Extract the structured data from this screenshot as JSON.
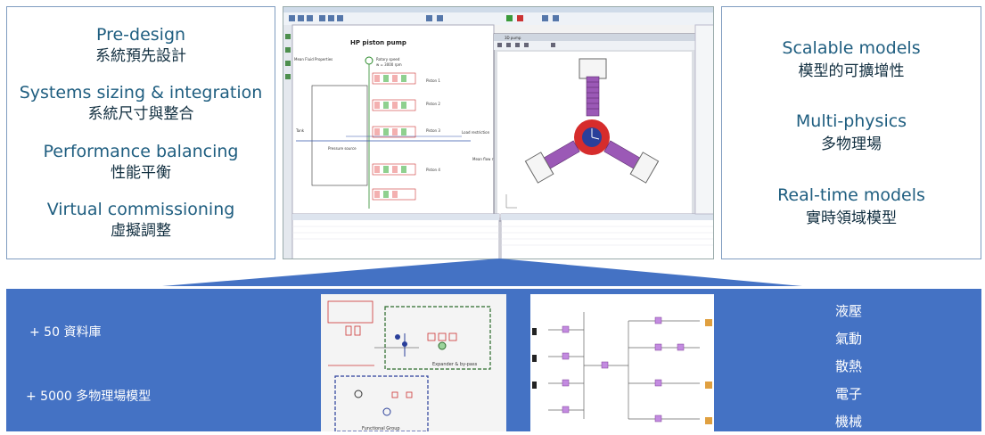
{
  "left_panel": {
    "items": [
      {
        "en": "Pre-design",
        "zh": "系統預先設計"
      },
      {
        "en": "Systems sizing & integration",
        "zh": "系統尺寸與整合"
      },
      {
        "en": "Performance balancing",
        "zh": "性能平衡"
      },
      {
        "en": "Virtual commissioning",
        "zh": "虛擬調整"
      }
    ]
  },
  "right_panel": {
    "items": [
      {
        "en": "Scalable models",
        "zh": "模型的可擴增性"
      },
      {
        "en": "Multi-physics",
        "zh": "多物理場"
      },
      {
        "en": "Real-time models",
        "zh": "實時領域模型"
      }
    ]
  },
  "screenshot": {
    "diagram_title": "HP piston pump",
    "window_3d_title": "3D pump",
    "labels": {
      "tank": "Tank",
      "pressure_source": "Pressure source",
      "load_restriction": "Load restriction",
      "piston_1": "Piston 1",
      "piston_2": "Piston 2",
      "piston_3": "Piston 3",
      "piston_4": "Piston 4",
      "rotary_speed": "Rotary speed",
      "rpm": "w = 3000 rpm",
      "mean_flow": "Mean flow rate",
      "fluid_props": "Mean Fluid Properties"
    }
  },
  "band": {
    "library_count": "+ 50 資料庫",
    "model_count": "+ 5000 多物理場模型",
    "domains": [
      "液壓",
      "氣動",
      "散熱",
      "電子",
      "機械"
    ]
  },
  "thumbnails": {
    "left": {
      "box_top": "Expander & by-pass",
      "box_bottom": "Functional Group"
    },
    "right": {}
  },
  "colors": {
    "band": "#4472c4",
    "panel_border": "#7f9cc0",
    "heading_text": "#1f5e80",
    "piston_purple": "#8e44ad",
    "hub_red": "#d62c2c",
    "hub_blue": "#2a3f9a"
  }
}
